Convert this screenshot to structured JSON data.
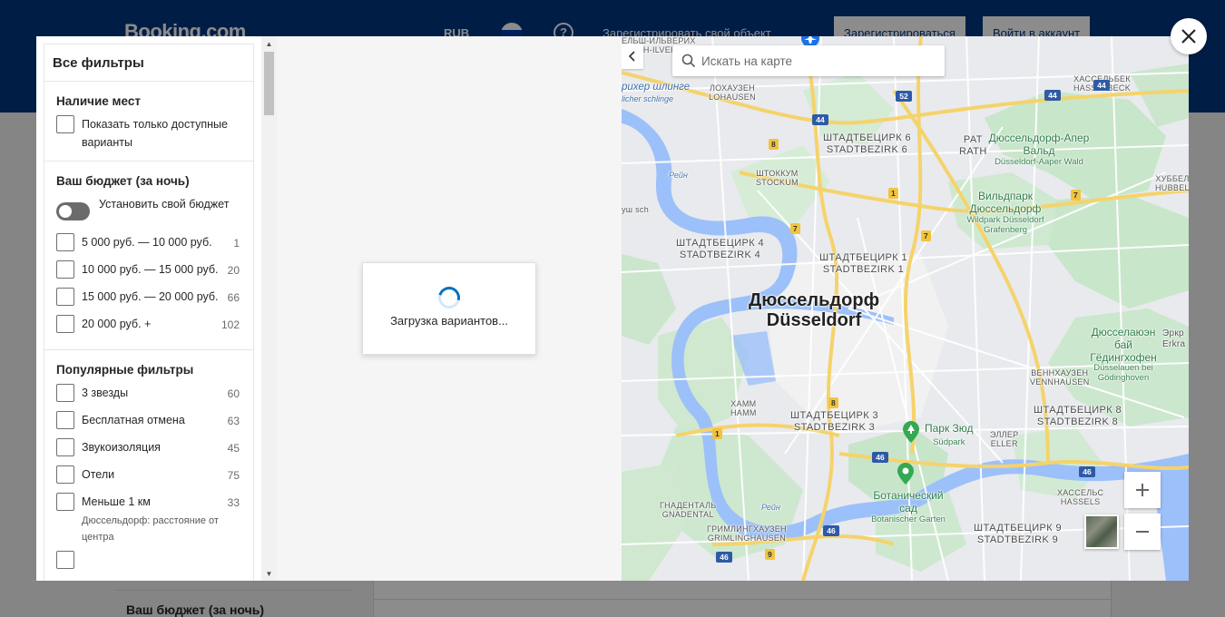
{
  "header": {
    "logo": "Booking.com",
    "currency": "RUB",
    "list_property": "Зарегистрировать свой объект",
    "register": "Зарегистрироваться",
    "signin": "Войти в аккаунт"
  },
  "background": {
    "side_budget_title": "Ваш бюджет (за ночь)"
  },
  "filters": {
    "title": "Все фильтры",
    "availability": {
      "title": "Наличие мест",
      "option": "Показать только доступные варианты"
    },
    "budget": {
      "title": "Ваш бюджет (за ночь)",
      "toggle_label": "Установить свой бюджет",
      "options": [
        {
          "label": "5 000 руб. — 10 000 руб.",
          "count": "1"
        },
        {
          "label": "10 000 руб. — 15 000 руб.",
          "count": "20"
        },
        {
          "label": "15 000 руб. — 20 000 руб.",
          "count": "66"
        },
        {
          "label": "20 000 руб. +",
          "count": "102"
        }
      ]
    },
    "popular": {
      "title": "Популярные фильтры",
      "options": [
        {
          "label": "3 звезды",
          "count": "60"
        },
        {
          "label": "Бесплатная отмена",
          "count": "63"
        },
        {
          "label": "Звукоизоляция",
          "count": "45"
        },
        {
          "label": "Отели",
          "count": "75"
        },
        {
          "label": "Меньше 1 км",
          "count": "33",
          "sub": "Дюссельдорф: расстояние от центра"
        }
      ]
    }
  },
  "results": {
    "loading_text": "Загрузка вариантов..."
  },
  "map": {
    "search_placeholder": "Искать на карте",
    "labels": {
      "city_ru": "Дюссельдорф",
      "city_de": "Düsseldorf",
      "d6_ru": "ШТАДТБЕЦИРК 6",
      "d6_de": "STADTBEZIRK 6",
      "d4_ru": "ШТАДТБЕЦИРК 4",
      "d4_de": "STADTBEZIRK 4",
      "d1_ru": "ШТАДТБЕЦИРК 1",
      "d1_de": "STADTBEZIRK 1",
      "d3_ru": "ШТАДТБЕЦИРК 3",
      "d3_de": "STADTBEZIRK 3",
      "d8_ru": "ШТАДТБЕЦИРК 8",
      "d8_de": "STADTBEZIRK 8",
      "d9_ru": "ШТАДТБЕЦИРК 9",
      "d9_de": "STADTBEZIRK 9",
      "lohausen_ru": "ЛОХАУЗЕН",
      "lohausen_de": "LOHAUSEN",
      "stockum_ru": "ШТОККУМ",
      "stockum_de": "STOCKUM",
      "rath_ru": "РАТ",
      "rath_de": "RATH",
      "hassels_north_ru": "ХАССЕЛЬБЕК",
      "hassels_north_de": "HASSELBECK",
      "hubbels_ru": "ХУББЕЛЬ",
      "hubbels_de": "HUBBELS",
      "hamm_ru": "ХАММ",
      "hamm_de": "HAMM",
      "eller_ru": "ЭЛЛЕР",
      "eller_de": "ELLER",
      "vennhausen_ru": "ВЕННХАУЗЕН",
      "vennhausen_de": "VENNHAUSEN",
      "hassels_ru": "ХАССЕЛЬС",
      "hassels_de": "HASSELS",
      "gnadental_ru": "ГНАДЕНТАЛЬ",
      "gnadental_de": "GNADENTAL",
      "grimlinghausen_ru": "ГРИМЛИНГХАУЗЕН",
      "grimlinghausen_de": "GRIMLINGHAUSEN",
      "kaiserswerth_top": "ЕЛЬШ-ИЛЬВЕРИХ",
      "kaiserswerth_top2": "BUSH-ILVERICH",
      "aaper_ru": "Дюссельдорф-Апер Вальд",
      "aaper_de": "Düsseldorf-Aaper Wald",
      "wildpark_ru": "Вильдпарк Дюссельдорф",
      "wildpark_de": "Wildpark Düsseldorf Grafenberg",
      "suedpark_ru": "Парк Зюд",
      "suedpark_de": "Südpark",
      "botanic_ru": "Ботанический сад",
      "botanic_de": "Botanischer Garten",
      "auen_ru": "Дюсселаюэн бай Гёдингхофен",
      "auen_de": "Düsselauen bei Gödinghoven",
      "erkrath": "Эркр Erkra",
      "river1": "Рейн",
      "river2": "Рейн",
      "ilverich": "рихер шлинге",
      "ilverich2": "licher schlinge",
      "kaarst": "уш sch"
    },
    "shields": [
      "44",
      "52",
      "44",
      "8",
      "1",
      "7",
      "7",
      "7",
      "8",
      "1",
      "46",
      "46",
      "46",
      "46",
      "9",
      "44"
    ]
  },
  "colors": {
    "header_bg": "#003580",
    "accent": "#0071c2",
    "water": "#9cc0f9",
    "park": "#c3e5c7",
    "motorway": "#f5d36b"
  }
}
